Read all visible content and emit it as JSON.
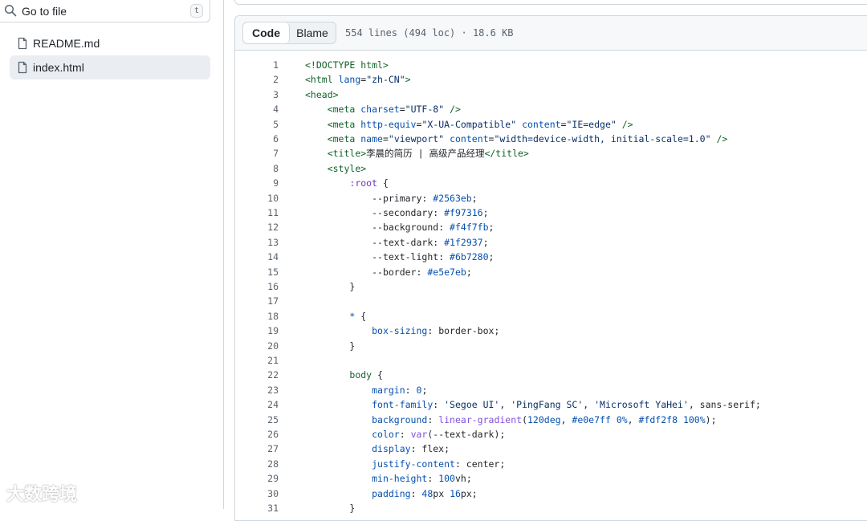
{
  "sidebar": {
    "search_text": "Go to file",
    "search_shortcut": "t",
    "files": [
      {
        "name": "README.md",
        "active": false
      },
      {
        "name": "index.html",
        "active": true
      }
    ]
  },
  "code_header": {
    "tab_code": "Code",
    "tab_blame": "Blame",
    "meta": "554 lines (494 loc) · 18.6 KB"
  },
  "code_lines": [
    {
      "n": "1",
      "tokens": [
        [
          "t-tag",
          "<!DOCTYPE html>"
        ]
      ]
    },
    {
      "n": "2",
      "tokens": [
        [
          "t-tag",
          "<html "
        ],
        [
          "t-kw",
          "lang"
        ],
        [
          "t-plain",
          "="
        ],
        [
          "t-str",
          "\"zh-CN\""
        ],
        [
          "t-tag",
          ">"
        ]
      ]
    },
    {
      "n": "3",
      "tokens": [
        [
          "t-tag",
          "<head>"
        ]
      ]
    },
    {
      "n": "4",
      "tokens": [
        [
          "t-plain",
          "    "
        ],
        [
          "t-tag",
          "<meta "
        ],
        [
          "t-kw",
          "charset"
        ],
        [
          "t-plain",
          "="
        ],
        [
          "t-str",
          "\"UTF-8\""
        ],
        [
          "t-plain",
          " "
        ],
        [
          "t-tag",
          "/>"
        ]
      ]
    },
    {
      "n": "5",
      "tokens": [
        [
          "t-plain",
          "    "
        ],
        [
          "t-tag",
          "<meta "
        ],
        [
          "t-kw",
          "http-equiv"
        ],
        [
          "t-plain",
          "="
        ],
        [
          "t-str",
          "\"X-UA-Compatible\""
        ],
        [
          "t-plain",
          " "
        ],
        [
          "t-kw",
          "content"
        ],
        [
          "t-plain",
          "="
        ],
        [
          "t-str",
          "\"IE=edge\""
        ],
        [
          "t-plain",
          " "
        ],
        [
          "t-tag",
          "/>"
        ]
      ]
    },
    {
      "n": "6",
      "tokens": [
        [
          "t-plain",
          "    "
        ],
        [
          "t-tag",
          "<meta "
        ],
        [
          "t-kw",
          "name"
        ],
        [
          "t-plain",
          "="
        ],
        [
          "t-str",
          "\"viewport\""
        ],
        [
          "t-plain",
          " "
        ],
        [
          "t-kw",
          "content"
        ],
        [
          "t-plain",
          "="
        ],
        [
          "t-str",
          "\"width=device-width, initial-scale=1.0\""
        ],
        [
          "t-plain",
          " "
        ],
        [
          "t-tag",
          "/>"
        ]
      ]
    },
    {
      "n": "7",
      "tokens": [
        [
          "t-plain",
          "    "
        ],
        [
          "t-tag",
          "<title>"
        ],
        [
          "t-plain",
          "李晨的简历 | 高级产品经理"
        ],
        [
          "t-tag",
          "</title>"
        ]
      ]
    },
    {
      "n": "8",
      "tokens": [
        [
          "t-plain",
          "    "
        ],
        [
          "t-tag",
          "<style>"
        ]
      ]
    },
    {
      "n": "9",
      "tokens": [
        [
          "t-plain",
          "        "
        ],
        [
          "t-sel",
          ":root"
        ],
        [
          "t-plain",
          " {"
        ]
      ]
    },
    {
      "n": "10",
      "tokens": [
        [
          "t-plain",
          "            "
        ],
        [
          "t-plain",
          "--primary"
        ],
        [
          "t-plain",
          ": "
        ],
        [
          "t-kw",
          "#2563eb"
        ],
        [
          "t-plain",
          ";"
        ]
      ]
    },
    {
      "n": "11",
      "tokens": [
        [
          "t-plain",
          "            "
        ],
        [
          "t-plain",
          "--secondary"
        ],
        [
          "t-plain",
          ": "
        ],
        [
          "t-kw",
          "#f97316"
        ],
        [
          "t-plain",
          ";"
        ]
      ]
    },
    {
      "n": "12",
      "tokens": [
        [
          "t-plain",
          "            "
        ],
        [
          "t-plain",
          "--background"
        ],
        [
          "t-plain",
          ": "
        ],
        [
          "t-kw",
          "#f4f7fb"
        ],
        [
          "t-plain",
          ";"
        ]
      ]
    },
    {
      "n": "13",
      "tokens": [
        [
          "t-plain",
          "            "
        ],
        [
          "t-plain",
          "--text-dark"
        ],
        [
          "t-plain",
          ": "
        ],
        [
          "t-kw",
          "#1f2937"
        ],
        [
          "t-plain",
          ";"
        ]
      ]
    },
    {
      "n": "14",
      "tokens": [
        [
          "t-plain",
          "            "
        ],
        [
          "t-plain",
          "--text-light"
        ],
        [
          "t-plain",
          ": "
        ],
        [
          "t-kw",
          "#6b7280"
        ],
        [
          "t-plain",
          ";"
        ]
      ]
    },
    {
      "n": "15",
      "tokens": [
        [
          "t-plain",
          "            "
        ],
        [
          "t-plain",
          "--border"
        ],
        [
          "t-plain",
          ": "
        ],
        [
          "t-kw",
          "#e5e7eb"
        ],
        [
          "t-plain",
          ";"
        ]
      ]
    },
    {
      "n": "16",
      "tokens": [
        [
          "t-plain",
          "        }"
        ]
      ]
    },
    {
      "n": "17",
      "tokens": [
        [
          "t-plain",
          ""
        ]
      ]
    },
    {
      "n": "18",
      "tokens": [
        [
          "t-plain",
          "        "
        ],
        [
          "t-kw",
          "*"
        ],
        [
          "t-plain",
          " {"
        ]
      ]
    },
    {
      "n": "19",
      "tokens": [
        [
          "t-plain",
          "            "
        ],
        [
          "t-prop",
          "box-sizing"
        ],
        [
          "t-plain",
          ": border-box;"
        ]
      ]
    },
    {
      "n": "20",
      "tokens": [
        [
          "t-plain",
          "        }"
        ]
      ]
    },
    {
      "n": "21",
      "tokens": [
        [
          "t-plain",
          ""
        ]
      ]
    },
    {
      "n": "22",
      "tokens": [
        [
          "t-plain",
          "        "
        ],
        [
          "t-tag",
          "body"
        ],
        [
          "t-plain",
          " {"
        ]
      ]
    },
    {
      "n": "23",
      "tokens": [
        [
          "t-plain",
          "            "
        ],
        [
          "t-prop",
          "margin"
        ],
        [
          "t-plain",
          ": "
        ],
        [
          "t-kw",
          "0"
        ],
        [
          "t-plain",
          ";"
        ]
      ]
    },
    {
      "n": "24",
      "tokens": [
        [
          "t-plain",
          "            "
        ],
        [
          "t-prop",
          "font-family"
        ],
        [
          "t-plain",
          ": "
        ],
        [
          "t-str",
          "'Segoe UI'"
        ],
        [
          "t-plain",
          ", "
        ],
        [
          "t-str",
          "'PingFang SC'"
        ],
        [
          "t-plain",
          ", "
        ],
        [
          "t-str",
          "'Microsoft YaHei'"
        ],
        [
          "t-plain",
          ", sans-serif;"
        ]
      ]
    },
    {
      "n": "25",
      "tokens": [
        [
          "t-plain",
          "            "
        ],
        [
          "t-prop",
          "background"
        ],
        [
          "t-plain",
          ": "
        ],
        [
          "t-fn",
          "linear-gradient"
        ],
        [
          "t-plain",
          "("
        ],
        [
          "t-kw",
          "120deg"
        ],
        [
          "t-plain",
          ", "
        ],
        [
          "t-kw",
          "#e0e7ff"
        ],
        [
          "t-plain",
          " "
        ],
        [
          "t-kw",
          "0%"
        ],
        [
          "t-plain",
          ", "
        ],
        [
          "t-kw",
          "#fdf2f8"
        ],
        [
          "t-plain",
          " "
        ],
        [
          "t-kw",
          "100%"
        ],
        [
          "t-plain",
          ");"
        ]
      ]
    },
    {
      "n": "26",
      "tokens": [
        [
          "t-plain",
          "            "
        ],
        [
          "t-prop",
          "color"
        ],
        [
          "t-plain",
          ": "
        ],
        [
          "t-fn",
          "var"
        ],
        [
          "t-plain",
          "(--text-dark);"
        ]
      ]
    },
    {
      "n": "27",
      "tokens": [
        [
          "t-plain",
          "            "
        ],
        [
          "t-prop",
          "display"
        ],
        [
          "t-plain",
          ": flex;"
        ]
      ]
    },
    {
      "n": "28",
      "tokens": [
        [
          "t-plain",
          "            "
        ],
        [
          "t-prop",
          "justify-content"
        ],
        [
          "t-plain",
          ": center;"
        ]
      ]
    },
    {
      "n": "29",
      "tokens": [
        [
          "t-plain",
          "            "
        ],
        [
          "t-prop",
          "min-height"
        ],
        [
          "t-plain",
          ": "
        ],
        [
          "t-kw",
          "100"
        ],
        [
          "t-plain",
          "vh;"
        ]
      ]
    },
    {
      "n": "30",
      "tokens": [
        [
          "t-plain",
          "            "
        ],
        [
          "t-prop",
          "padding"
        ],
        [
          "t-plain",
          ": "
        ],
        [
          "t-kw",
          "48"
        ],
        [
          "t-plain",
          "px "
        ],
        [
          "t-kw",
          "16"
        ],
        [
          "t-plain",
          "px;"
        ]
      ]
    },
    {
      "n": "31",
      "tokens": [
        [
          "t-plain",
          "        }"
        ]
      ]
    }
  ],
  "watermark": "大数跨境",
  "colors": {
    "border": "#d0d7de",
    "header_bg": "#f6f8fa",
    "active_file_bg": "#eaedf1"
  }
}
